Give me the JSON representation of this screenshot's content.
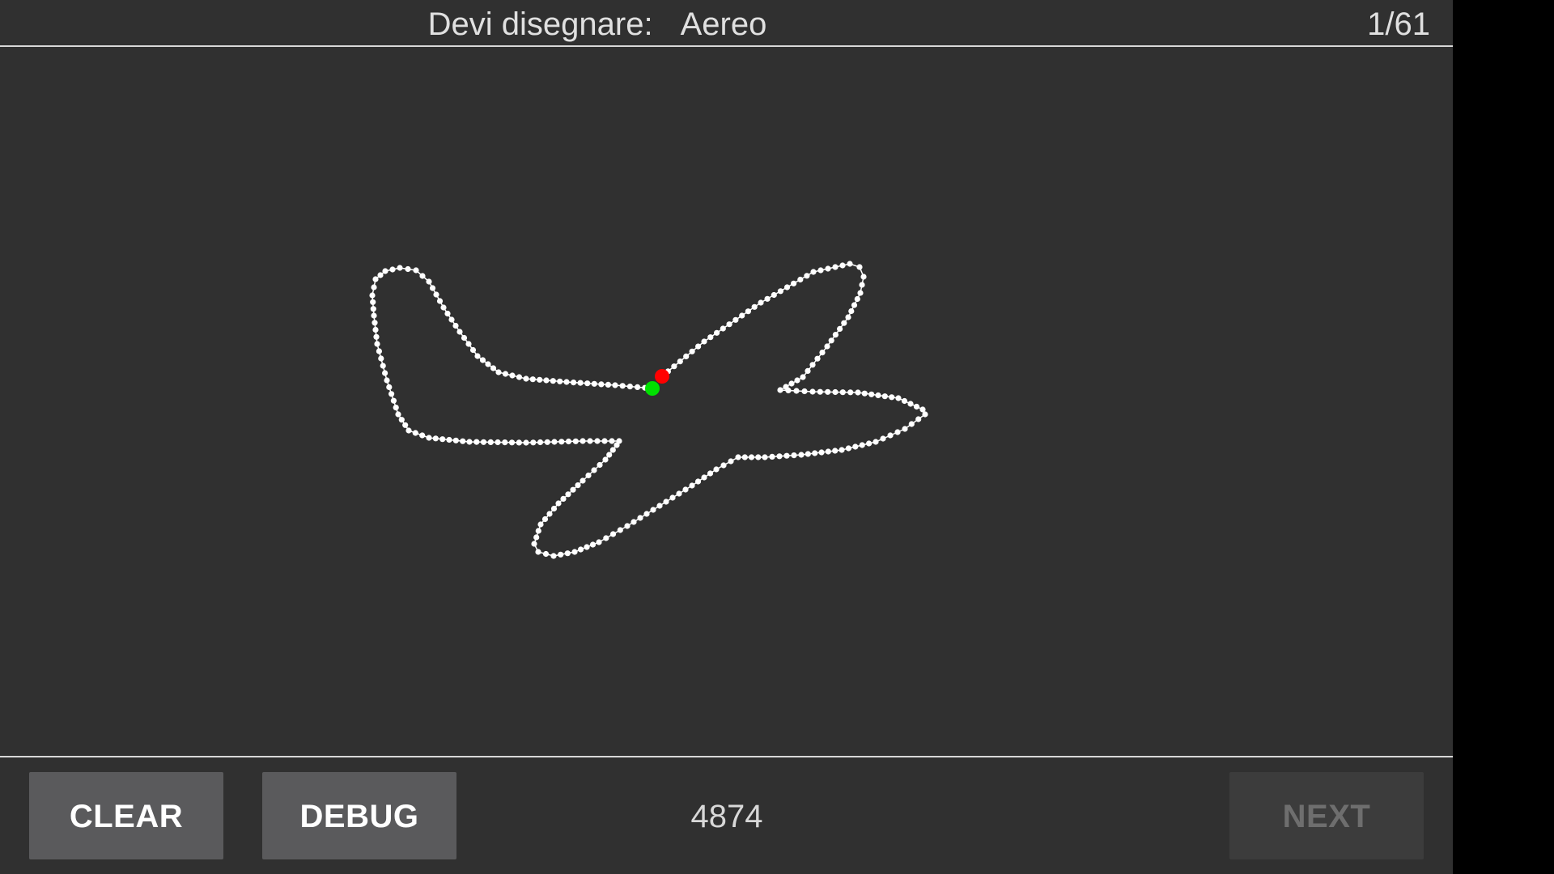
{
  "header": {
    "prompt_label": "Devi disegnare:",
    "target_word": "Aereo",
    "progress": "1/61"
  },
  "drawing": {
    "stroke_color": "#ffffff",
    "start_marker_color": "#00e000",
    "end_marker_color": "#ff0000"
  },
  "footer": {
    "clear_label": "CLEAR",
    "debug_label": "DEBUG",
    "score": "4874",
    "next_label": "NEXT"
  }
}
